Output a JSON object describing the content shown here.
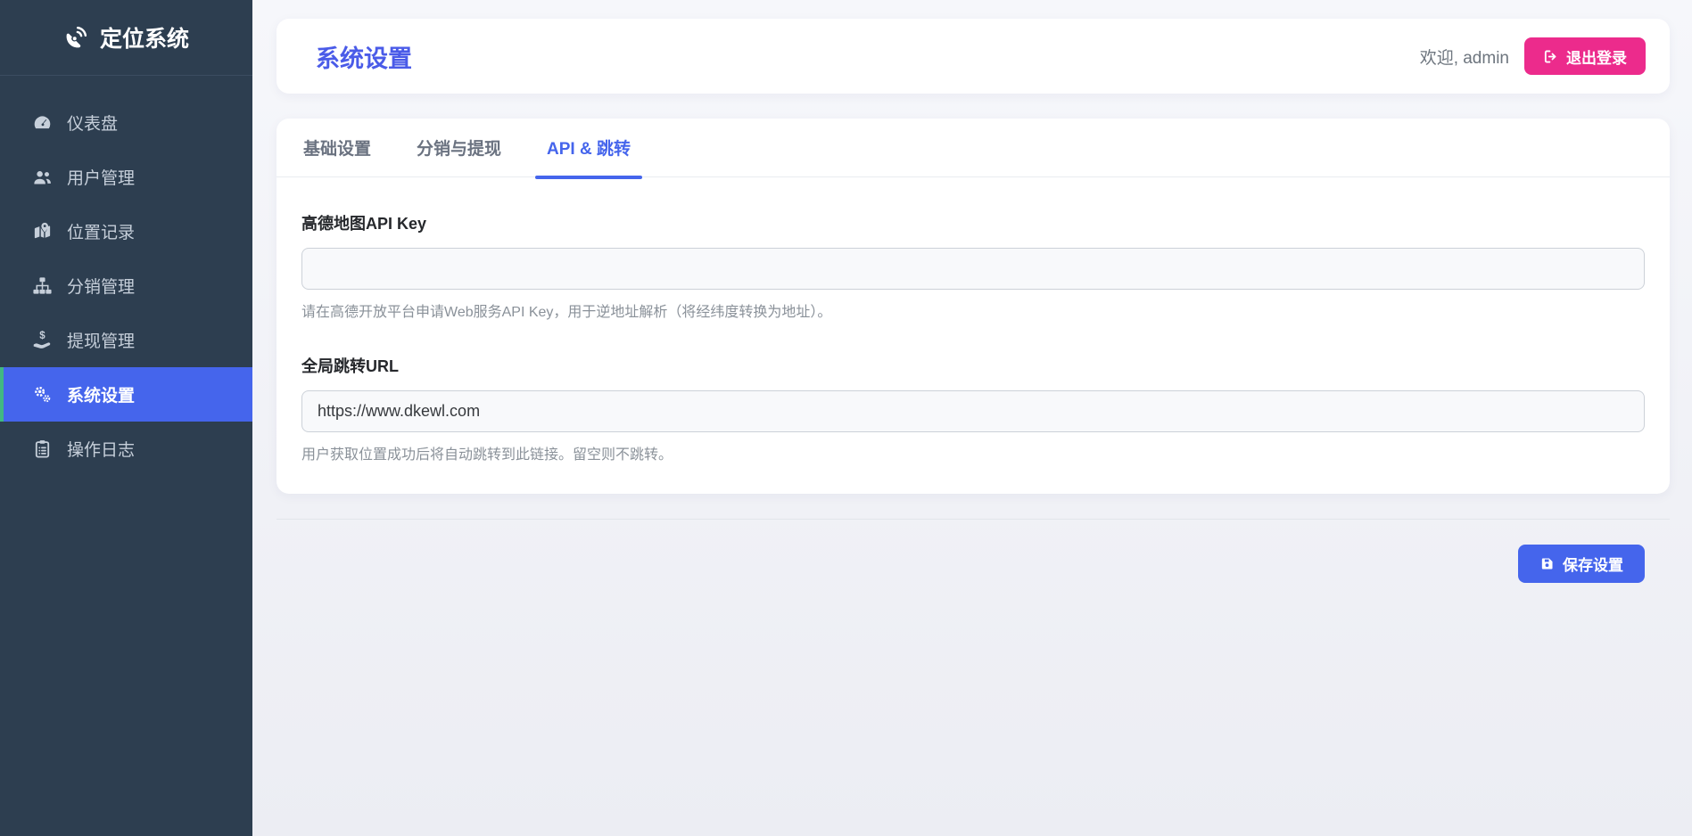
{
  "app": {
    "title": "定位系统",
    "logo_icon": "satellite-dish-icon"
  },
  "sidebar": {
    "items": [
      {
        "label": "仪表盘",
        "icon": "tachometer-icon",
        "active": false
      },
      {
        "label": "用户管理",
        "icon": "users-icon",
        "active": false
      },
      {
        "label": "位置记录",
        "icon": "map-marked-icon",
        "active": false
      },
      {
        "label": "分销管理",
        "icon": "sitemap-icon",
        "active": false
      },
      {
        "label": "提现管理",
        "icon": "hand-holding-usd-icon",
        "active": false
      },
      {
        "label": "系统设置",
        "icon": "cogs-icon",
        "active": true
      },
      {
        "label": "操作日志",
        "icon": "clipboard-list-icon",
        "active": false
      }
    ]
  },
  "header": {
    "title": "系统设置",
    "welcome": "欢迎, admin",
    "logout_label": "退出登录",
    "logout_icon": "sign-out-icon"
  },
  "tabs": [
    {
      "label": "基础设置",
      "active": false
    },
    {
      "label": "分销与提现",
      "active": false
    },
    {
      "label": "API & 跳转",
      "active": true
    }
  ],
  "form": {
    "amap_key": {
      "label": "高德地图API Key",
      "value": "",
      "placeholder": "",
      "help": "请在高德开放平台申请Web服务API Key，用于逆地址解析（将经纬度转换为地址）。"
    },
    "redirect_url": {
      "label": "全局跳转URL",
      "value": "https://www.dkewl.com",
      "placeholder": "",
      "help": "用户获取位置成功后将自动跳转到此链接。留空则不跳转。"
    }
  },
  "actions": {
    "save_label": "保存设置",
    "save_icon": "save-icon"
  },
  "colors": {
    "sidebar_bg": "#2d3e50",
    "accent_blue": "#4565ec",
    "active_nav_border_green": "#41b883",
    "logout_pink": "#ec2b8c",
    "title_blue": "#4a5be8",
    "page_bg": "#eef0f5"
  }
}
